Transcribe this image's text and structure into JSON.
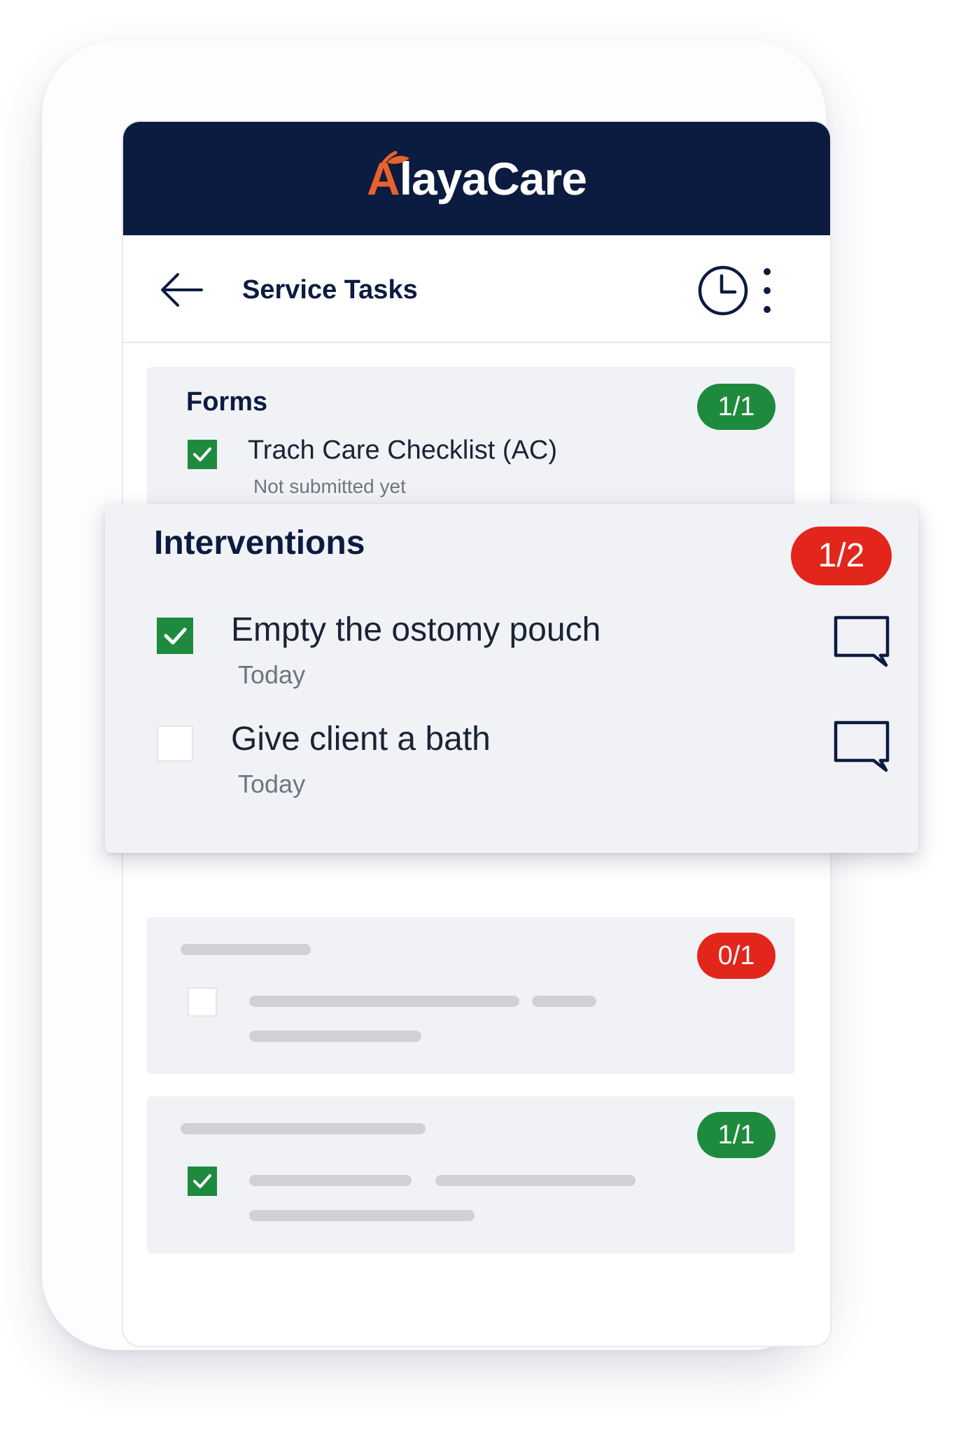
{
  "brand": {
    "name_first_letter": "A",
    "name_rest": "layaCare",
    "bar_color": "#0c1b40",
    "accent_color": "#e8622c"
  },
  "appbar": {
    "title": "Service Tasks",
    "back_icon": "arrow-left-icon",
    "history_icon": "clock-icon",
    "menu_icon": "more-vertical-icon"
  },
  "forms_card": {
    "title": "Forms",
    "badge": "1/1",
    "badge_color": "#1e8a3d",
    "items": [
      {
        "label": "Trach Care Checklist (AC)",
        "status": "Not submitted yet",
        "checked": true
      }
    ]
  },
  "interventions_card": {
    "title": "Interventions",
    "badge": "1/2",
    "badge_color": "#e2261c",
    "items": [
      {
        "label": "Empty the ostomy pouch",
        "due": "Today",
        "checked": true,
        "comment_icon": "comment-icon"
      },
      {
        "label": "Give client a bath",
        "due": "Today",
        "checked": false,
        "comment_icon": "comment-icon"
      }
    ]
  },
  "placeholder_cards": [
    {
      "badge": "0/1",
      "badge_color": "#e2261c",
      "checked": false
    },
    {
      "badge": "1/1",
      "badge_color": "#1e8a3d",
      "checked": true
    }
  ]
}
